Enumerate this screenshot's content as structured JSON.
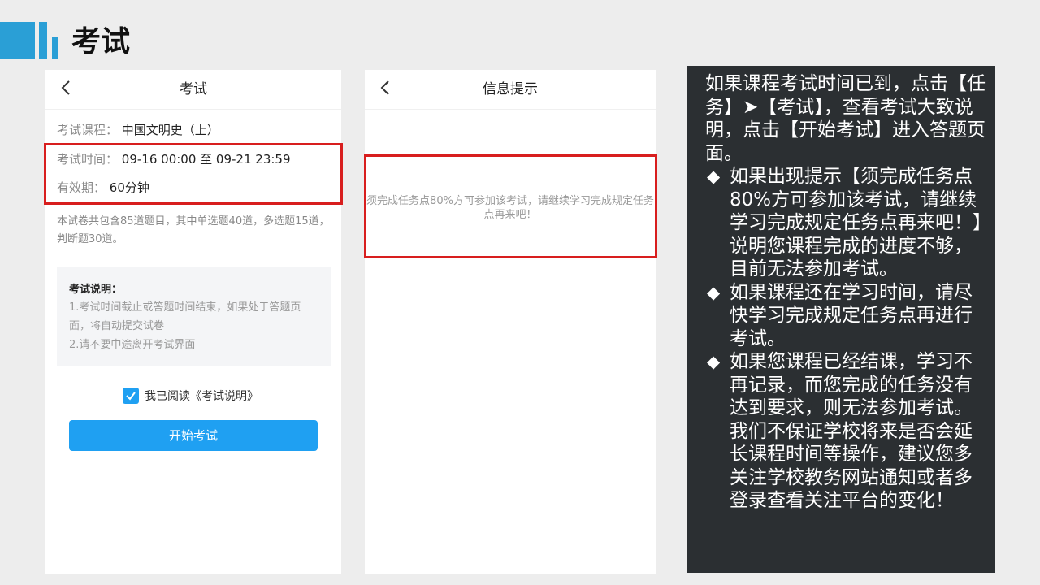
{
  "header": {
    "title": "考试"
  },
  "exam_screen": {
    "nav_title": "考试",
    "course_label": "考试课程：",
    "course_value": "中国文明史（上）",
    "time_label": "考试时间：",
    "time_value": "09-16 00:00 至 09-21 23:59",
    "validity_label": "有效期：",
    "validity_value": "60分钟",
    "summary": "本试卷共包含85道题目，其中单选题40道，多选题15道，判断题30道。",
    "notes_title": "考试说明：",
    "notes": [
      "1.考试时间截止或答题时间结束，如果处于答题页面，将自动提交试卷",
      "2.请不要中途离开考试界面"
    ],
    "agree_checked": true,
    "agree_text": "我已阅读《考试说明》",
    "start_button": "开始考试"
  },
  "info_screen": {
    "nav_title": "信息提示",
    "message": "须完成任务点80%方可参加该考试，请继续学习完成规定任务点再来吧！"
  },
  "explanation": {
    "intro": "如果课程考试时间已到，点击【任务】➤【考试】，查看考试大致说明，点击【开始考试】进入答题页面。",
    "bullet_symbol": "◆",
    "bullets": [
      "如果出现提示【须完成任务点80%方可参加该考试，请继续学习完成规定任务点再来吧！】说明您课程完成的进度不够，目前无法参加考试。",
      "如果课程还在学习时间，请尽快学习完成规定任务点再进行考试。",
      "如果您课程已经结课，学习不再记录，而您完成的任务没有达到要求，则无法参加考试。我们不保证学校将来是否会延长课程时间等操作，建议您多关注学校教务网站通知或者多登录查看关注平台的变化！"
    ]
  },
  "colors": {
    "accent": "#2a9fd6",
    "button": "#1fa0f2",
    "highlight": "#d81e1e",
    "panel": "#2b2f32"
  }
}
